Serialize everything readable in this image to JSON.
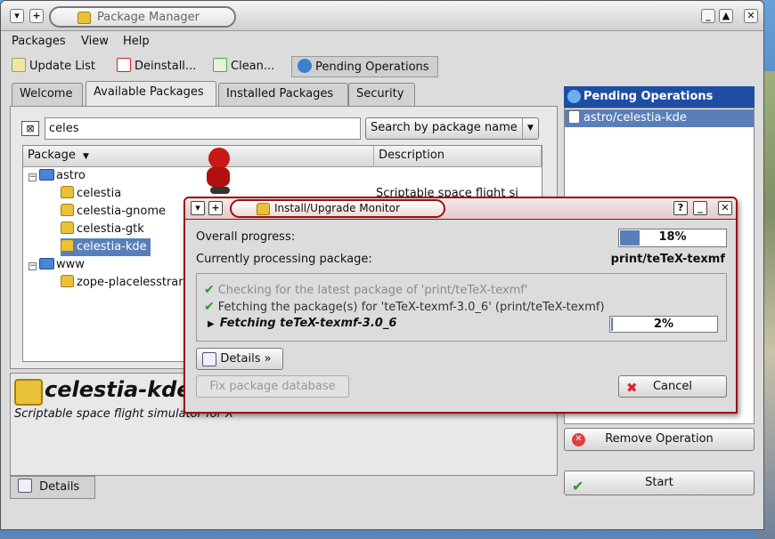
{
  "window": {
    "title": "Package Manager"
  },
  "menu": {
    "packages": "Packages",
    "view": "View",
    "help": "Help"
  },
  "toolbar": {
    "update": "Update List",
    "deinstall": "Deinstall...",
    "clean": "Clean...",
    "pending": "Pending Operations"
  },
  "tabs": [
    "Welcome",
    "Available Packages",
    "Installed Packages",
    "Security"
  ],
  "search": {
    "value": "celes",
    "mode": "Search by package name"
  },
  "tree": {
    "columns": [
      "Package",
      "Description"
    ],
    "rows": [
      {
        "label": "astro",
        "type": "folder",
        "description": ""
      },
      {
        "label": "celestia",
        "type": "pkg",
        "description": "Scriptable space flight si"
      },
      {
        "label": "celestia-gnome",
        "type": "pkg",
        "description": ""
      },
      {
        "label": "celestia-gtk",
        "type": "pkg",
        "description": ""
      },
      {
        "label": "celestia-kde",
        "type": "pkg",
        "description": ""
      },
      {
        "label": "www",
        "type": "folder",
        "description": ""
      },
      {
        "label": "zope-placelesstrar",
        "type": "pkg",
        "description": ""
      }
    ]
  },
  "info": {
    "name": "celestia-kde",
    "description": "Scriptable space flight simulator for X"
  },
  "details_tab": "Details",
  "pending": {
    "title": "Pending Operations",
    "items": [
      "astro/celestia-kde"
    ],
    "remove": "Remove Operation",
    "start": "Start"
  },
  "dialog": {
    "title": "Install/Upgrade Monitor",
    "overall_label": "Overall progress:",
    "overall_value": 18,
    "overall_text": "18%",
    "current_label": "Currently processing package:",
    "current_pkg": "print/teTeX-texmf",
    "log": [
      "Checking for the latest package of 'print/teTeX-texmf'",
      "Fetching the package(s) for 'teTeX-texmf-3.0_6' (print/teTeX-texmf)"
    ],
    "active_step": "Fetching teTeX-texmf-3.0_6",
    "step_value": 2,
    "step_text": "2%",
    "details": "Details »",
    "fix": "Fix package database",
    "cancel": "Cancel"
  },
  "colors": {
    "accent": "#5a7fb8",
    "dialog_border": "#9a1111",
    "pending_header": "#1e4ea4"
  }
}
